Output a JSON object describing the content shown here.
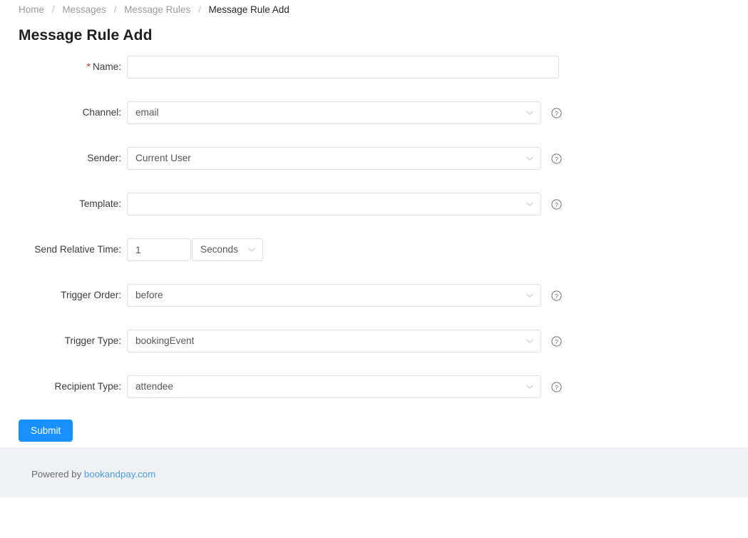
{
  "breadcrumb": {
    "separator": "/",
    "items": [
      {
        "label": "Home",
        "current": false
      },
      {
        "label": "Messages",
        "current": false
      },
      {
        "label": "Message Rules",
        "current": false
      },
      {
        "label": "Message Rule Add",
        "current": true
      }
    ]
  },
  "page": {
    "title": "Message Rule Add"
  },
  "form": {
    "required_marker": "*",
    "rows": {
      "name": {
        "label": "Name:",
        "value": "",
        "placeholder": ""
      },
      "channel": {
        "label": "Channel:",
        "value": "email"
      },
      "sender": {
        "label": "Sender:",
        "value": "Current User"
      },
      "template": {
        "label": "Template:",
        "value": ""
      },
      "relative": {
        "label": "Send Relative Time:",
        "amount": "1",
        "unit": "Seconds"
      },
      "trigger_order": {
        "label": "Trigger Order:",
        "value": "before"
      },
      "trigger_type": {
        "label": "Trigger Type:",
        "value": "bookingEvent"
      },
      "recipient_type": {
        "label": "Recipient Type:",
        "value": "attendee"
      }
    }
  },
  "actions": {
    "submit_label": "Submit"
  },
  "footer": {
    "prefix": "Powered by ",
    "link_label": "bookandpay.com"
  },
  "icons": {
    "help": "question-circle-icon",
    "chevron": "chevron-down-icon"
  },
  "colors": {
    "primary": "#1890ff",
    "required": "#d93025",
    "link": "#4a9bf5",
    "footer_bg": "#f0f2f5",
    "border": "#dcdfe3"
  }
}
